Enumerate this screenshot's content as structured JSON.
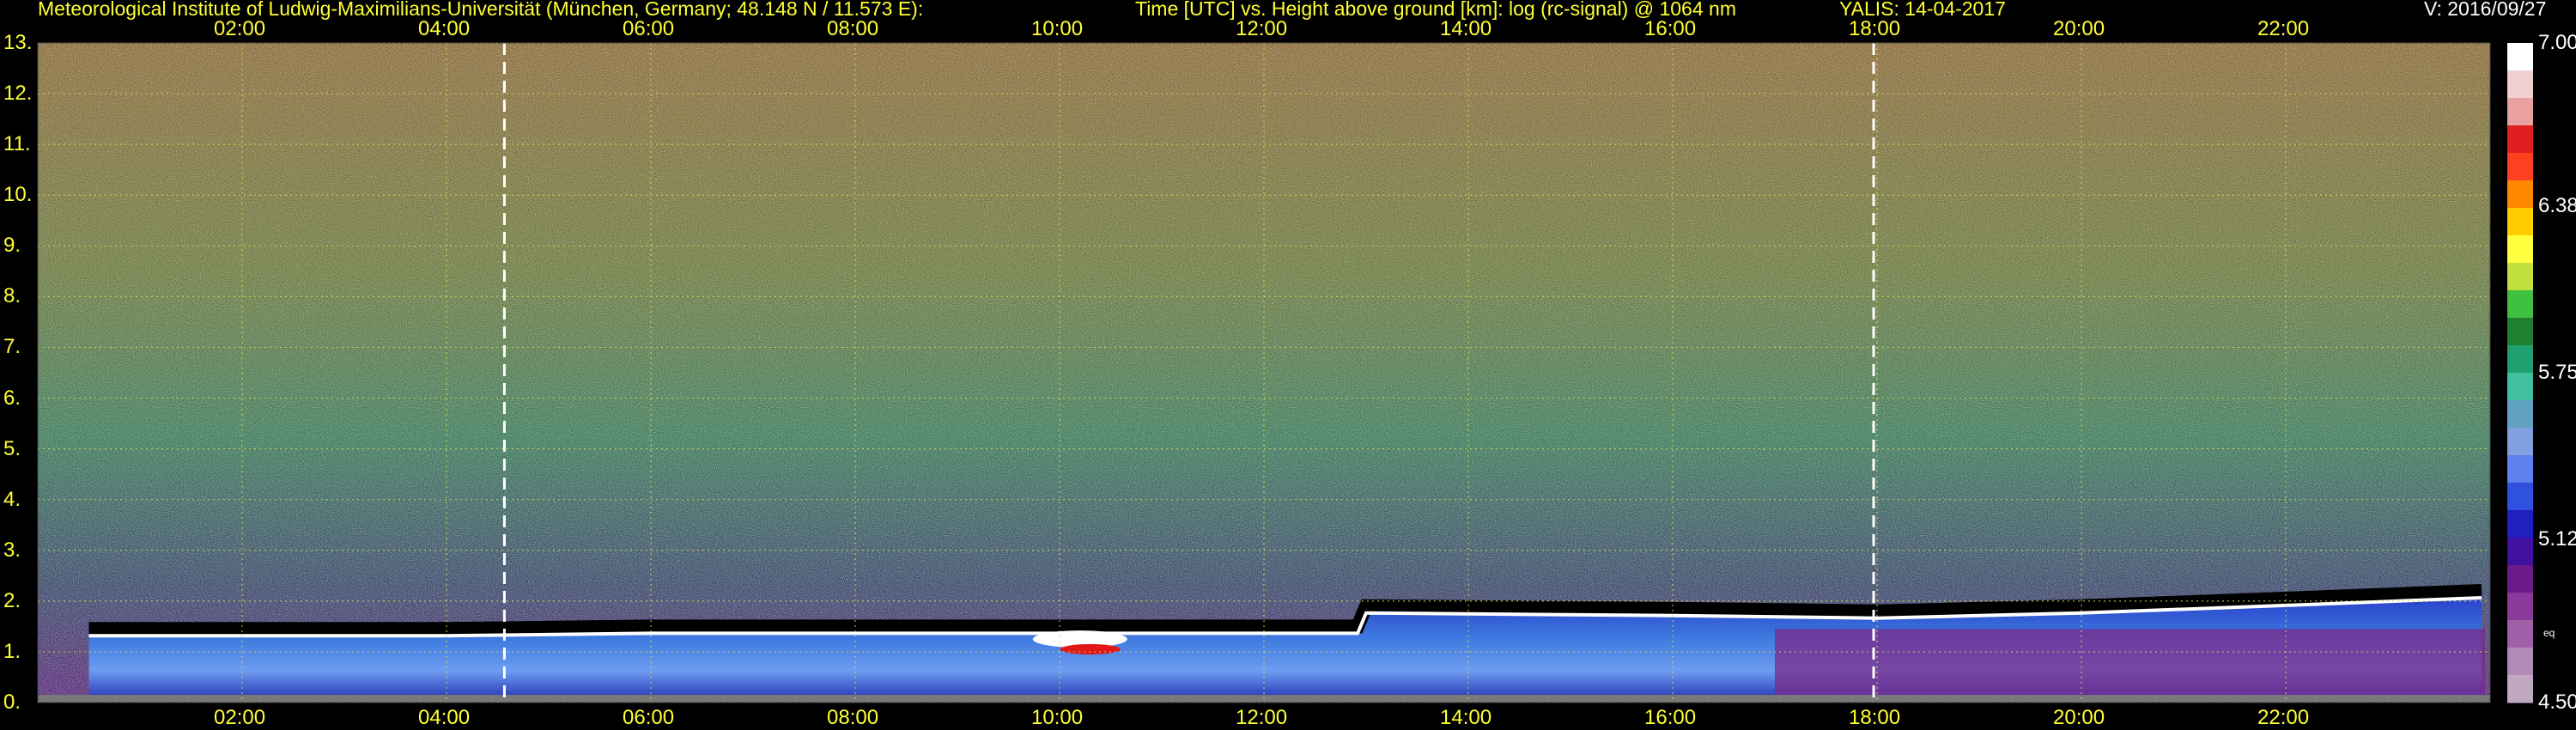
{
  "header": {
    "institute": "Meteorological Institute of Ludwig-Maximilians-Universität (München, Germany; 48.148 N / 11.573 E):",
    "plot_desc": "Time [UTC] vs. Height above ground [km]: log (rc-signal) @ 1064 nm",
    "station_date": "YALIS: 14-04-2017",
    "version": "V: 2016/09/27"
  },
  "colors": {
    "label": "#ffff33",
    "grid": "#d8d850",
    "marker": "#ffffff",
    "background": "#000000"
  },
  "colorbar": {
    "min": 4.5,
    "max": 7.0,
    "labels": [
      "7.00",
      "6.38",
      "5.75",
      "5.12",
      "4.50"
    ],
    "small_label": "eq"
  },
  "chart_data": {
    "type": "heatmap",
    "title": "Time [UTC] vs. Height above ground [km]: log (rc-signal) @ 1064 nm",
    "xlabel": "Time [UTC]",
    "ylabel": "Height above ground [km]",
    "xlim_hours": [
      0.0,
      24.0
    ],
    "ylim_km": [
      0,
      13
    ],
    "x_ticks": [
      "02:00",
      "04:00",
      "06:00",
      "08:00",
      "10:00",
      "12:00",
      "14:00",
      "16:00",
      "18:00",
      "20:00",
      "22:00"
    ],
    "y_ticks": [
      "0.",
      "1.",
      "2.",
      "3.",
      "4.",
      "5.",
      "6.",
      "7.",
      "8.",
      "9.",
      "10.",
      "11.",
      "12.",
      "13."
    ],
    "grid": true,
    "marker_times_utc": [
      "04:34",
      "17:58"
    ],
    "colorbar_range": [
      4.5,
      7.0
    ],
    "colorbar_ticks": [
      7.0,
      6.38,
      5.75,
      5.12,
      4.5
    ],
    "boundary_layer_top_km": [
      {
        "time": "00:30",
        "height": 1.45
      },
      {
        "time": "02:00",
        "height": 1.45
      },
      {
        "time": "04:00",
        "height": 1.45
      },
      {
        "time": "06:00",
        "height": 1.5
      },
      {
        "time": "08:00",
        "height": 1.5
      },
      {
        "time": "10:00",
        "height": 1.5
      },
      {
        "time": "12:00",
        "height": 1.5
      },
      {
        "time": "12:55",
        "height": 1.5
      },
      {
        "time": "13:00",
        "height": 1.9
      },
      {
        "time": "16:00",
        "height": 1.85
      },
      {
        "time": "18:00",
        "height": 1.8
      },
      {
        "time": "20:00",
        "height": 1.9
      },
      {
        "time": "22:00",
        "height": 2.05
      },
      {
        "time": "23:55",
        "height": 2.2
      }
    ]
  }
}
